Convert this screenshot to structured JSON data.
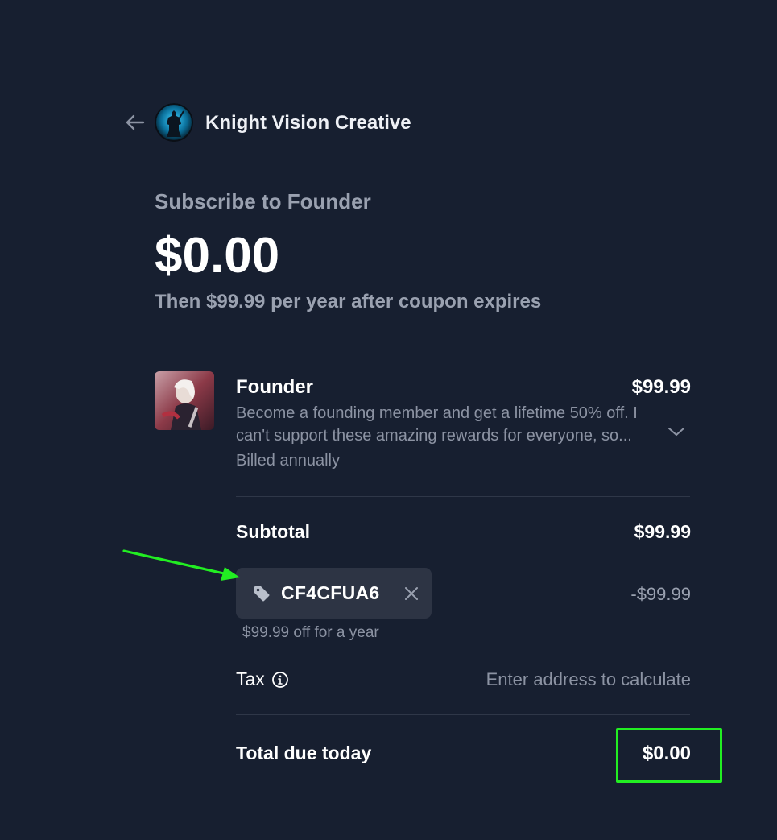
{
  "header": {
    "back_icon": "arrow-left-icon",
    "merchant_name": "Knight Vision Creative",
    "avatar_icon": "knight-silhouette-avatar"
  },
  "summary": {
    "title": "Subscribe to Founder",
    "price": "$0.00",
    "renewal_text": "Then $99.99 per year after coupon expires"
  },
  "line_item": {
    "name": "Founder",
    "price": "$99.99",
    "description": "Become a founding member and get a lifetime 50% off. I can't support these amazing rewards for everyone, so...",
    "billing": "Billed annually",
    "expand_icon": "chevron-down-icon"
  },
  "subtotal": {
    "label": "Subtotal",
    "value": "$99.99"
  },
  "coupon": {
    "code": "CF4CFUA6",
    "discount": "-$99.99",
    "note": "$99.99 off for a year",
    "tag_icon": "tag-icon",
    "remove_icon": "close-icon"
  },
  "tax": {
    "label": "Tax",
    "value": "Enter address to calculate",
    "info_icon": "info-icon"
  },
  "total": {
    "label": "Total due today",
    "value": "$0.00"
  },
  "annotations": {
    "arrow_color": "#22ee22",
    "highlight_color": "#22ee22"
  },
  "colors": {
    "background": "#171f30",
    "muted_text": "#8c93a3",
    "chip_background": "#2d3444",
    "divider": "#2f3748"
  }
}
